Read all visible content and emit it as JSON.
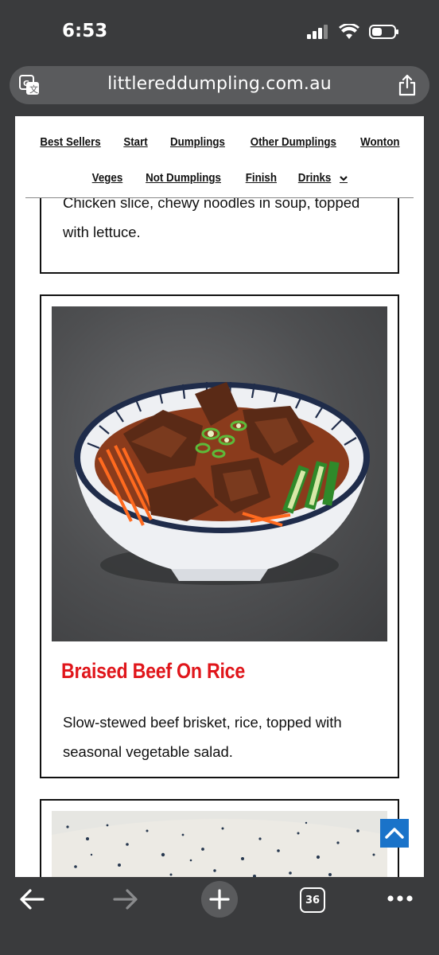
{
  "status": {
    "time": "6:53"
  },
  "browser": {
    "url": "littlereddumpling.com.au",
    "tab_count": "36"
  },
  "nav": {
    "row1": [
      "Best Sellers",
      "Start",
      "Dumplings",
      "Other Dumplings",
      "Wonton"
    ],
    "row2": [
      "Veges",
      "Not Dumplings",
      "Finish",
      "Drinks"
    ]
  },
  "cards": {
    "previous": {
      "description": "Chicken slice, chewy noodles in soup, topped with lettuce."
    },
    "main": {
      "title": "Braised Beef On Rice",
      "description": "Slow-stewed beef brisket, rice, topped with seasonal vegetable salad."
    }
  },
  "colors": {
    "accent": "#e0161b",
    "scroll_button": "#1a73c9",
    "browser_chrome": "#3a3b3d"
  },
  "icons": [
    "translate-icon",
    "share-icon",
    "back-arrow-icon",
    "forward-arrow-icon",
    "plus-icon",
    "tabs-icon",
    "more-icon",
    "chevron-down-icon",
    "chevron-up-icon",
    "signal-icon",
    "wifi-icon",
    "battery-icon"
  ]
}
